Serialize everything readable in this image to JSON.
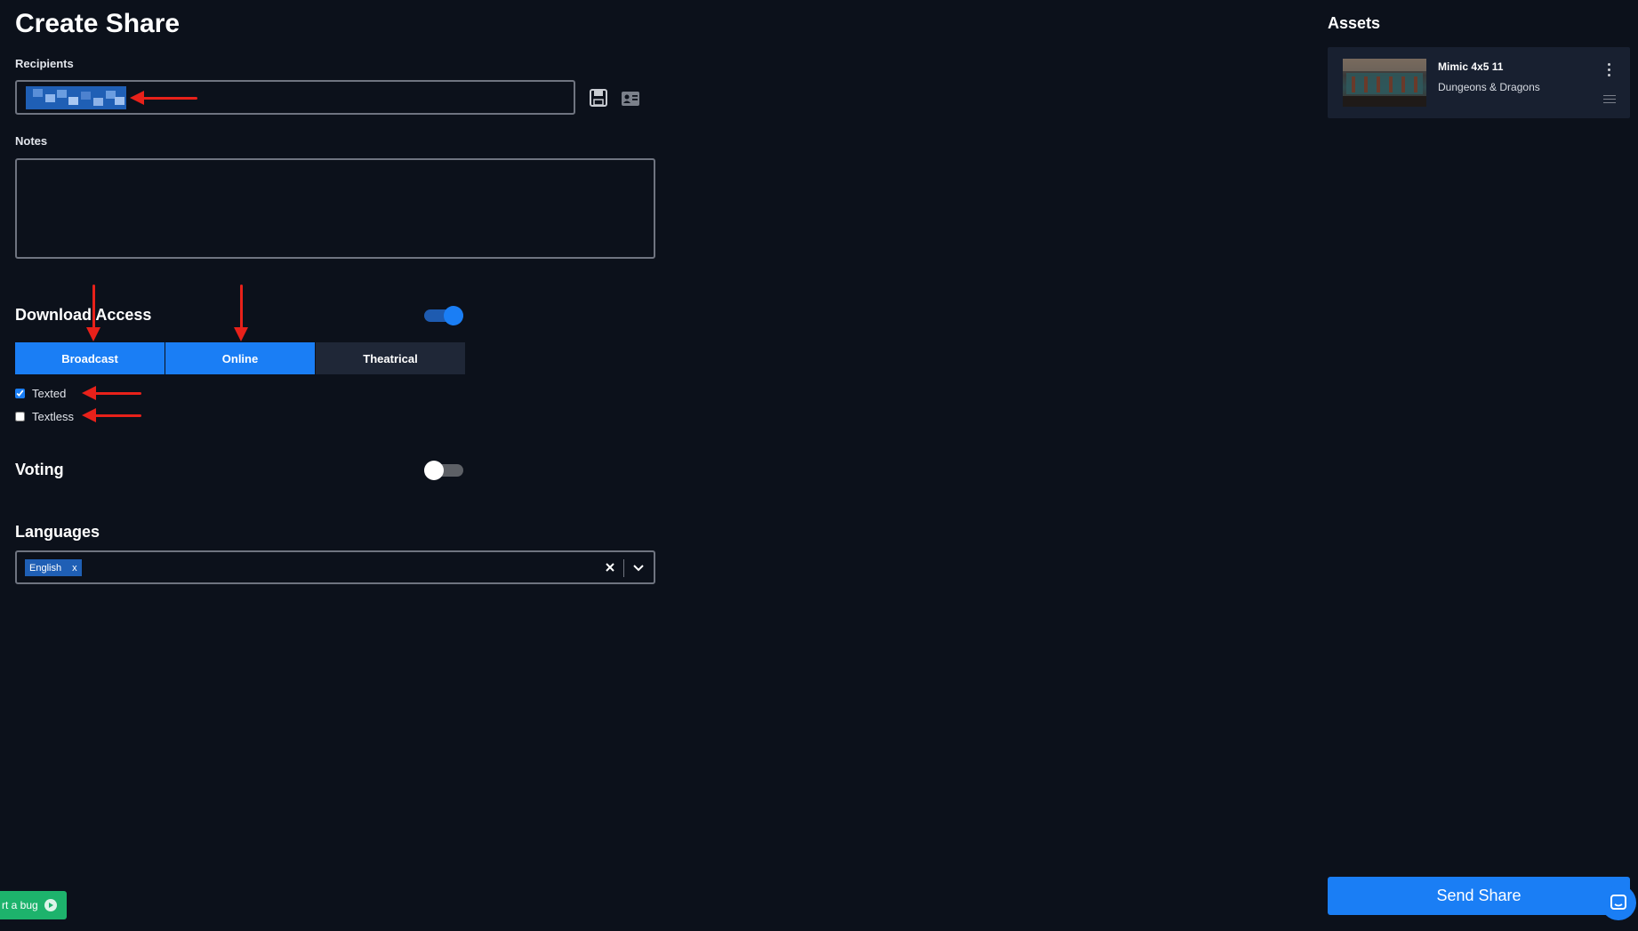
{
  "page": {
    "title": "Create Share"
  },
  "recipients": {
    "label": "Recipients"
  },
  "notes": {
    "label": "Notes",
    "value": ""
  },
  "download_access": {
    "title": "Download Access",
    "enabled": true,
    "segments": [
      {
        "label": "Broadcast",
        "active": true
      },
      {
        "label": "Online",
        "active": true
      },
      {
        "label": "Theatrical",
        "active": false
      }
    ],
    "options": [
      {
        "label": "Texted",
        "checked": true
      },
      {
        "label": "Textless",
        "checked": false
      }
    ]
  },
  "voting": {
    "title": "Voting",
    "enabled": false
  },
  "languages": {
    "title": "Languages",
    "selected": [
      {
        "label": "English",
        "remove": "x"
      }
    ]
  },
  "assets": {
    "title": "Assets",
    "items": [
      {
        "name": "Mimic 4x5 11",
        "subtitle": "Dungeons & Dragons"
      }
    ]
  },
  "actions": {
    "send_label": "Send Share"
  },
  "bug_report": {
    "label": "rt a bug"
  },
  "colors": {
    "background": "#0c111b",
    "accent": "#1a7ef5",
    "annotation": "#e8211a",
    "bug": "#1db36c"
  }
}
